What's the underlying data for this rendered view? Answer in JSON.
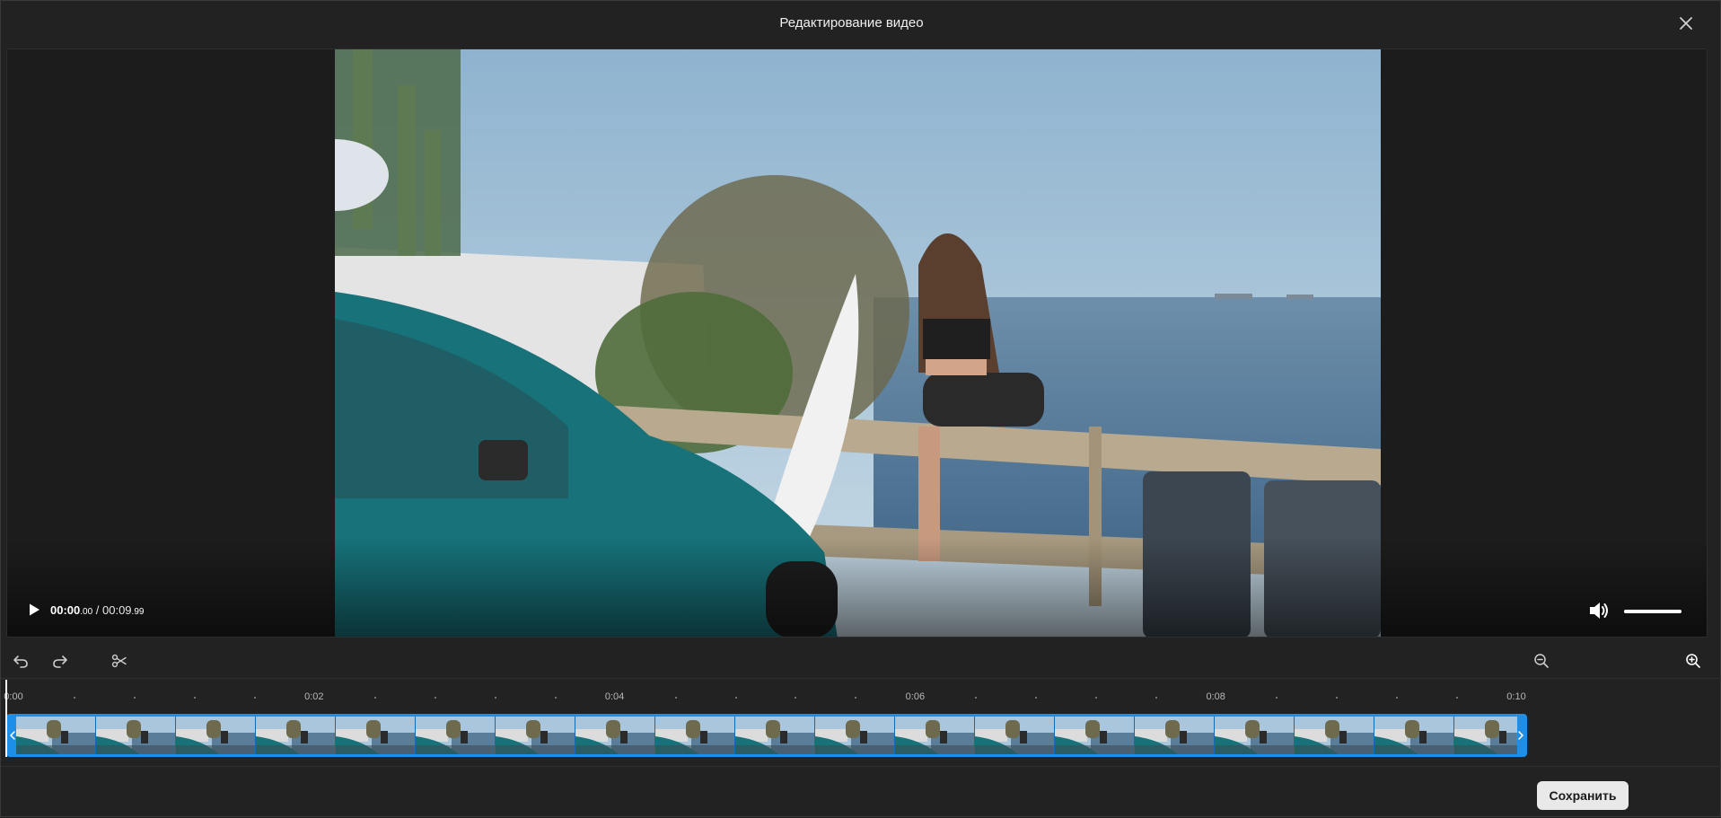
{
  "dialog": {
    "title": "Редактирование видео",
    "close_icon": "close-icon"
  },
  "player": {
    "current_time_main": "00:00",
    "current_time_ms": ".00",
    "separator": " / ",
    "total_time_main": "00:09",
    "total_time_ms": ".99",
    "play_icon": "play-icon",
    "volume_icon": "speaker-volume-icon",
    "volume_level": 1.0
  },
  "toolbar": {
    "undo_icon": "undo-icon",
    "redo_icon": "redo-icon",
    "split_icon": "scissors-icon",
    "zoom_out_icon": "zoom-out-icon",
    "zoom_in_icon": "zoom-in-icon"
  },
  "timeline": {
    "ticks": [
      "0:00",
      "0:02",
      "0:04",
      "0:06",
      "0:08",
      "0:10"
    ],
    "thumbnail_count": 19
  },
  "footer": {
    "save_label": "Сохранить"
  },
  "colors": {
    "accent": "#1d8fe8",
    "background": "#222222",
    "sky": "#a9c6dc",
    "sea": "#5a7d99",
    "car": "#17727a"
  }
}
